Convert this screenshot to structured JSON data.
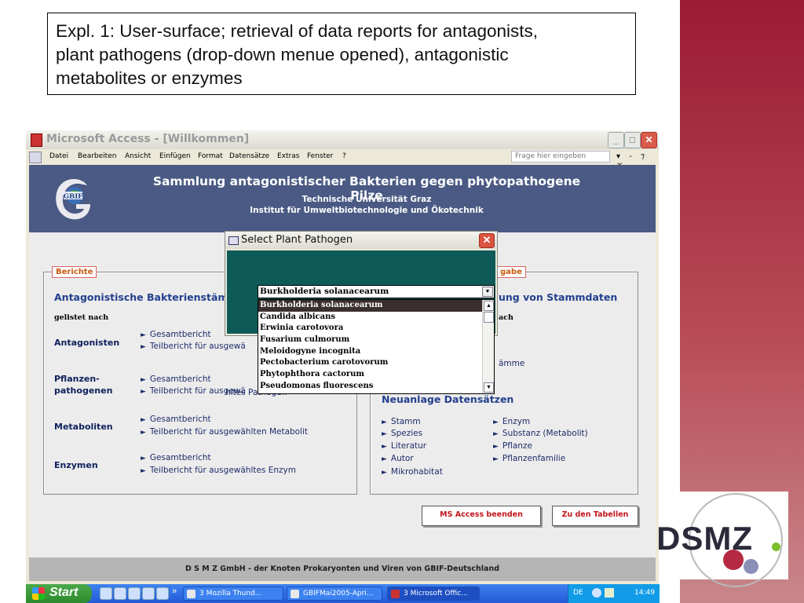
{
  "caption": {
    "lines": [
      "Expl. 1: User-surface; retrieval of data reports for antagonists,",
      "plant pathogens (drop-down menue opened), antagonistic",
      "metabolites or enzymes"
    ]
  },
  "window": {
    "title": "Microsoft Access - [Willkommen]",
    "min": "_",
    "max": "□",
    "close": "✕",
    "menu": [
      "Datei",
      "Bearbeiten",
      "Ansicht",
      "Einfügen",
      "Format",
      "Datensätze",
      "Extras",
      "Fenster",
      "?"
    ],
    "help_placeholder": "Frage hier eingeben",
    "mdi_controls": "▾ - ⁊ ×"
  },
  "form": {
    "logo_text": "GBIF",
    "title": "Sammlung antagonistischer Bakterien gegen phytopathogene Pilze",
    "subtitle1": "Technische Universität Graz",
    "subtitle2": "Institut für Umweltbiotechnologie und Ökotechnik",
    "left_panel": {
      "legend": "Berichte",
      "heading": "Antagonistische Bakterienstämm",
      "listed_by": "gelistet nach",
      "rows": [
        {
          "label_lines": [
            "Antagonisten"
          ],
          "links": [
            "Gesamtbericht",
            "Teilbericht für ausgewä"
          ]
        },
        {
          "label_lines": [
            "Pflanzen-",
            "pathogenen"
          ],
          "links": [
            "Gesamtbericht",
            "Teilbericht für ausgewä"
          ]
        },
        {
          "label_lines": [
            "Metaboliten"
          ],
          "links": [
            "Gesamtbericht",
            "Teilbericht für ausgewählten Metabolit"
          ]
        },
        {
          "label_lines": [
            "Enzymen"
          ],
          "links": [
            "Gesamtbericht",
            "Teilbericht für ausgewähltes Enzym"
          ]
        }
      ],
      "row2_link2_tail": "hltes Pathogen"
    },
    "right_panel": {
      "legend": "gabe",
      "heading": "ung von Stammdaten",
      "sub": "ach",
      "item": "ämme",
      "new_heading": "Neuanlage Datensätzen",
      "col1": [
        "Stamm",
        "Spezies",
        "Literatur",
        "Autor",
        "Mikrohabitat"
      ],
      "col2": [
        "Enzym",
        "Substanz (Metabolit)",
        "Pflanze",
        "Pflanzenfamilie"
      ]
    },
    "buttons": {
      "quit": "MS Access beenden",
      "tables": "Zu den Tabellen"
    },
    "footer": "D S M Z GmbH - der Knoten Prokaryonten und Viren von GBIF-Deutschland"
  },
  "dialog": {
    "title": "Select Plant Pathogen",
    "combo_value": "Burkholderia solanacearum",
    "options": [
      "Burkholderia solanacearum",
      "Candida albicans",
      "Erwinia carotovora",
      "Fusarium culmorum",
      "Meloidogyne incognita",
      "Pectobacterium carotovorum",
      "Phytophthora cactorum",
      "Pseudomonas fluorescens"
    ],
    "selected_index": 0
  },
  "taskbar": {
    "start": "Start",
    "chevron": "»",
    "tasks": [
      "3 Mozilla Thund...",
      "GBIFMai2005-Apri...",
      "3 Microsoft Offic..."
    ],
    "lang": "DE",
    "time": "14:49"
  },
  "logo_dsmz": "DSMZ",
  "colors": {
    "brand_band": "#9b1b33",
    "header_blue": "#4a5a84",
    "dialog_teal": "#0e5a58",
    "link_blue": "#1e2d6a",
    "button_red": "#c4161c"
  }
}
